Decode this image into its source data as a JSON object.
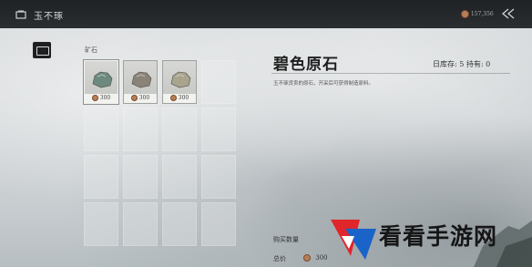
{
  "topbar": {
    "title": "玉不琢",
    "currency": "157,356"
  },
  "category": "矿石",
  "items": [
    {
      "price": "300",
      "selected": true,
      "color": "#6e8a80"
    },
    {
      "price": "300",
      "selected": false,
      "color": "#8a8478"
    },
    {
      "price": "300",
      "selected": false,
      "color": "#a8a48e"
    }
  ],
  "detail": {
    "title": "碧色原石",
    "stock": "日库存: 5  持有: 0",
    "description": "玉不琢货卖的原石，开采后可获得制造原料。",
    "quantity_label": "购买数量",
    "total_label": "总价",
    "total_value": "300"
  },
  "watermark": "看看手游网",
  "colors": {
    "topbar": "#24282b",
    "coin": "#b87f56",
    "logo_red": "#e0262b",
    "logo_blue": "#1a63c8"
  }
}
